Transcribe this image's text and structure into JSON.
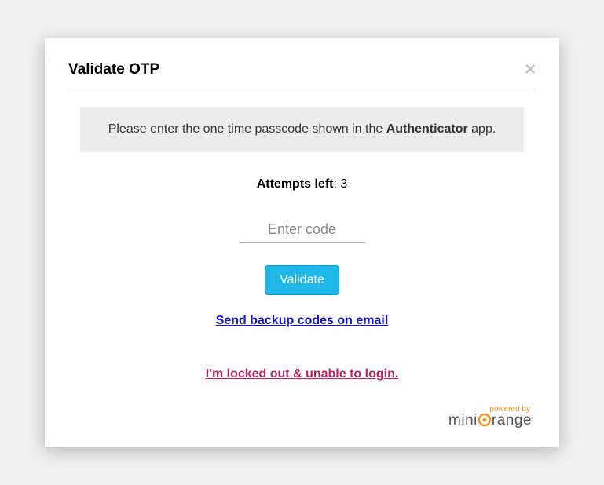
{
  "modal": {
    "title": "Validate OTP",
    "close_label": "×"
  },
  "instruction": {
    "prefix": "Please enter the one time passcode shown in the ",
    "bold": "Authenticator",
    "suffix": " app."
  },
  "attempts": {
    "label": "Attempts left",
    "separator": ": ",
    "value": "3"
  },
  "input": {
    "placeholder": "Enter code",
    "value": ""
  },
  "buttons": {
    "validate": "Validate"
  },
  "links": {
    "backup": "Send backup codes on email",
    "locked_out": "I'm locked out & unable to login."
  },
  "footer": {
    "powered_by": "powered by",
    "brand_mini": "mini",
    "brand_o": "o",
    "brand_range": "range"
  }
}
